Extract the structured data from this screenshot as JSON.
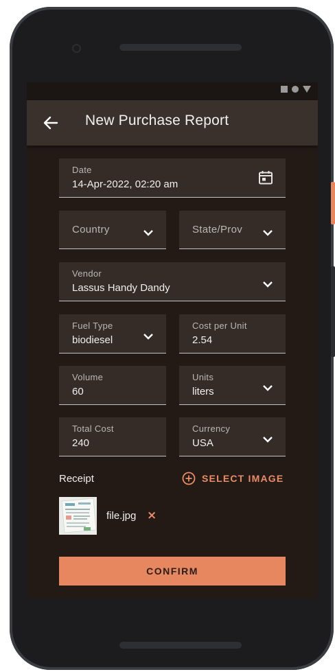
{
  "status_bar": {
    "icons": [
      "square-icon",
      "circle-icon",
      "triangle-icon"
    ]
  },
  "app_bar": {
    "back_icon": "arrow-left-icon",
    "title": "New Purchase Report"
  },
  "form": {
    "date": {
      "label": "Date",
      "value": "14-Apr-2022, 02:20 am",
      "icon": "calendar-icon"
    },
    "country": {
      "placeholder": "Country"
    },
    "state": {
      "placeholder": "State/Prov"
    },
    "vendor": {
      "label": "Vendor",
      "value": "Lassus Handy Dandy"
    },
    "fuel_type": {
      "label": "Fuel Type",
      "value": "biodiesel"
    },
    "cost_per_unit": {
      "label": "Cost per Unit",
      "value": "2.54"
    },
    "volume": {
      "label": "Volume",
      "value": "60"
    },
    "units": {
      "label": "Units",
      "value": "liters"
    },
    "total_cost": {
      "label": "Total Cost",
      "value": "240"
    },
    "currency": {
      "label": "Currency",
      "value": "USA"
    }
  },
  "receipt": {
    "label": "Receipt",
    "select_image_label": "SELECT IMAGE",
    "file_name": "file.jpg",
    "remove_label": "×"
  },
  "confirm_label": "CONFIRM",
  "colors": {
    "accent": "#e6875f",
    "screen_bg": "#231915",
    "app_bar_bg": "#3b312c",
    "field_bg": "#352c28"
  }
}
